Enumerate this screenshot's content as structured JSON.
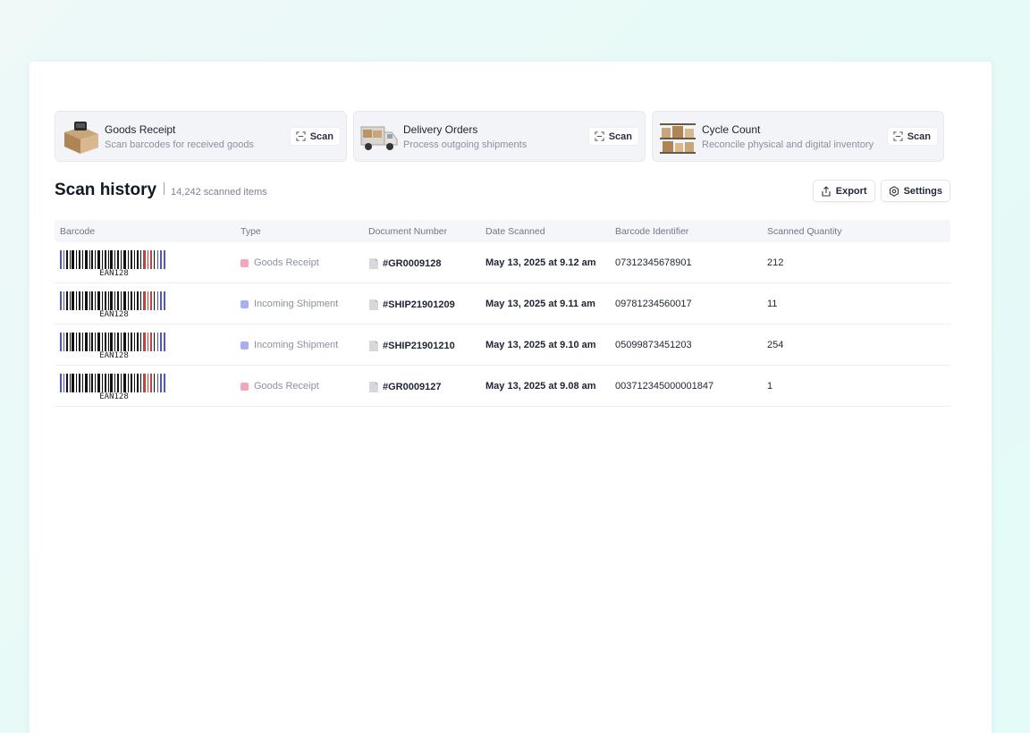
{
  "cards": [
    {
      "title": "Goods Receipt",
      "subtitle": "Scan barcodes for received goods",
      "button": "Scan",
      "thumb": "box-icon"
    },
    {
      "title": "Delivery Orders",
      "subtitle": "Process outgoing shipments",
      "button": "Scan",
      "thumb": "truck-icon"
    },
    {
      "title": "Cycle Count",
      "subtitle": "Reconcile physical and digital inventory",
      "button": "Scan",
      "thumb": "shelves-icon"
    }
  ],
  "history": {
    "title": "Scan history",
    "count": "14,242 scanned items",
    "export_label": "Export",
    "settings_label": "Settings"
  },
  "table": {
    "columns": [
      "Barcode",
      "Type",
      "Document Number",
      "Date Scanned",
      "Barcode Identifier",
      "Scanned Quantity"
    ],
    "rows": [
      {
        "barcode_label": "EAN128",
        "type": "Goods Receipt",
        "type_color": "#f3a6b8",
        "document": "#GR0009128",
        "date": "May 13, 2025 at 9.12 am",
        "identifier": "07312345678901",
        "quantity": "212"
      },
      {
        "barcode_label": "EAN128",
        "type": "Incoming Shipment",
        "type_color": "#a9aef2",
        "document": "#SHIP21901209",
        "date": "May 13, 2025 at 9.11 am",
        "identifier": "09781234560017",
        "quantity": "11"
      },
      {
        "barcode_label": "EAN128",
        "type": "Incoming Shipment",
        "type_color": "#a9aef2",
        "document": "#SHIP21901210",
        "date": "May 13, 2025 at 9.10 am",
        "identifier": "05099873451203",
        "quantity": "254"
      },
      {
        "barcode_label": "EAN128",
        "type": "Goods Receipt",
        "type_color": "#f3a6b8",
        "document": "#GR0009127",
        "date": "May 13, 2025 at 9.08 am",
        "identifier": "003712345000001847",
        "quantity": "1"
      }
    ]
  },
  "colors": {
    "accent_text": "#1b2233",
    "muted": "#8a90a2",
    "goods_receipt": "#f3a6b8",
    "incoming_shipment": "#a9aef2"
  }
}
